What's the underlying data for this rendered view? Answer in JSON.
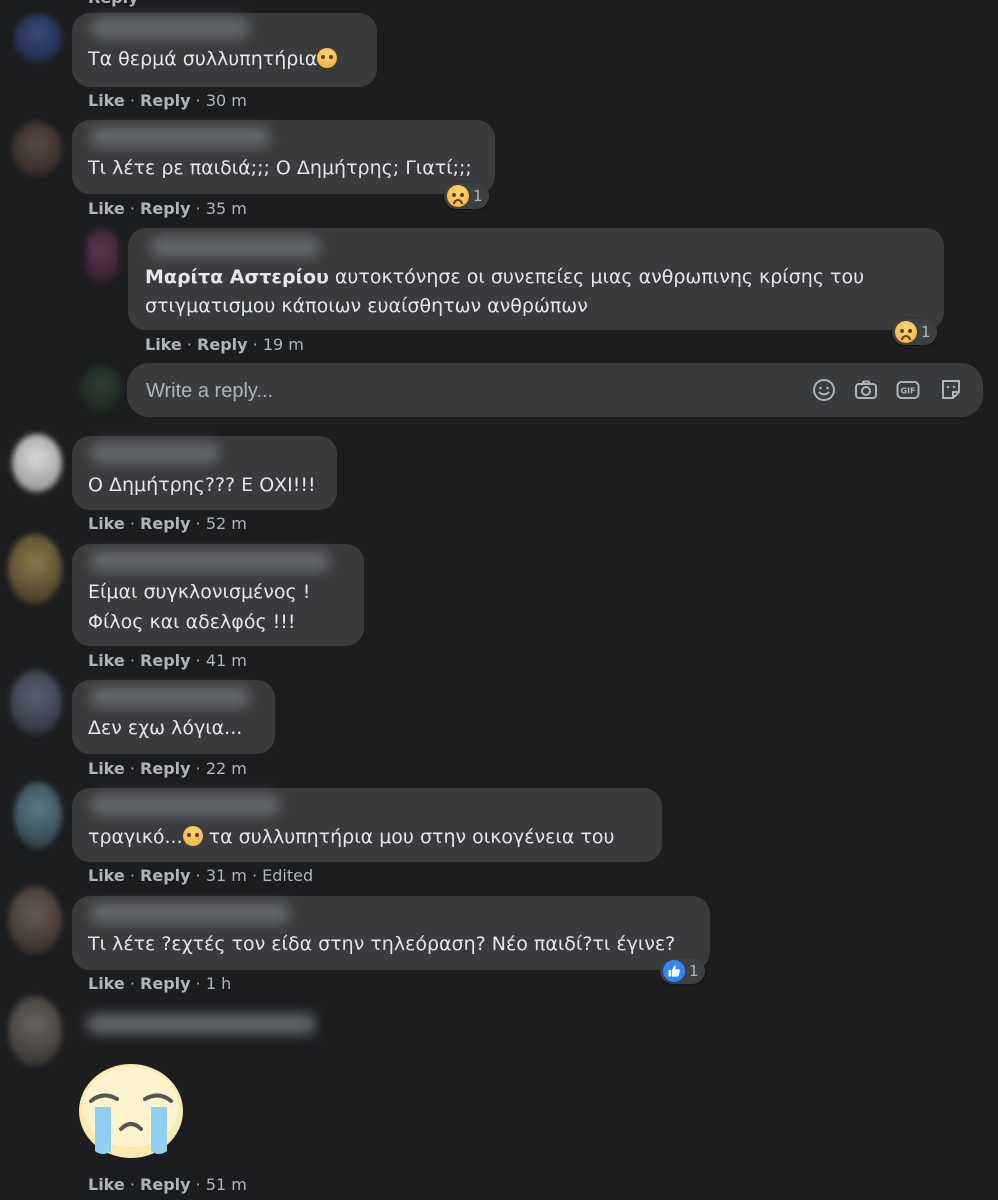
{
  "actions": {
    "like": "Like",
    "reply": "Reply",
    "edited": "Edited"
  },
  "comments": [
    {
      "text": "Τα θερμά συλλυπητήρια",
      "time": "30 m"
    },
    {
      "text": "Τι λέτε ρε παιδιά;;; Ο Δημήτρης; Γιατί;;;",
      "time": "35 m",
      "reaction": {
        "type": "sad",
        "count": "1"
      }
    },
    {
      "author": "Μαρίτα Αστερίου",
      "line1": "αυτοκτόνησε οι συνεπείες μιας ανθρωπινης κρίσης του",
      "line2": "στιγματισμου κάποιων ευαίσθητων ανθρώπων",
      "time": "19 m",
      "reaction": {
        "type": "sad",
        "count": "1"
      }
    },
    {
      "text": "Ο Δημήτρης??? Ε ΟΧΙ!!!",
      "time": "52 m"
    },
    {
      "line1": "Είμαι συγκλονισμένος !",
      "line2": "Φίλος και αδελφός !!!",
      "time": "41 m"
    },
    {
      "text": "Δεν εχω λόγια...",
      "time": "22 m"
    },
    {
      "text_before": "τραγικό...",
      "text_after": " τα συλλυπητήρια μου στην οικογένεια του",
      "time": "31 m"
    },
    {
      "text": "Τι λέτε ?εχτές τον είδα στην τηλεόραση? Νέο παιδί?τι έγινε?",
      "time": "1 h",
      "reaction": {
        "type": "like",
        "count": "1"
      }
    },
    {
      "sticker": "crying-face",
      "time": "51 m"
    }
  ],
  "write_reply": {
    "placeholder": "Write a reply..."
  },
  "colors": {
    "background": "#1c1d1f",
    "bubble": "#3a3b3c",
    "text": "#e4e6eb",
    "meta": "#b0b3b8",
    "like_blue": "#2d88ff"
  }
}
